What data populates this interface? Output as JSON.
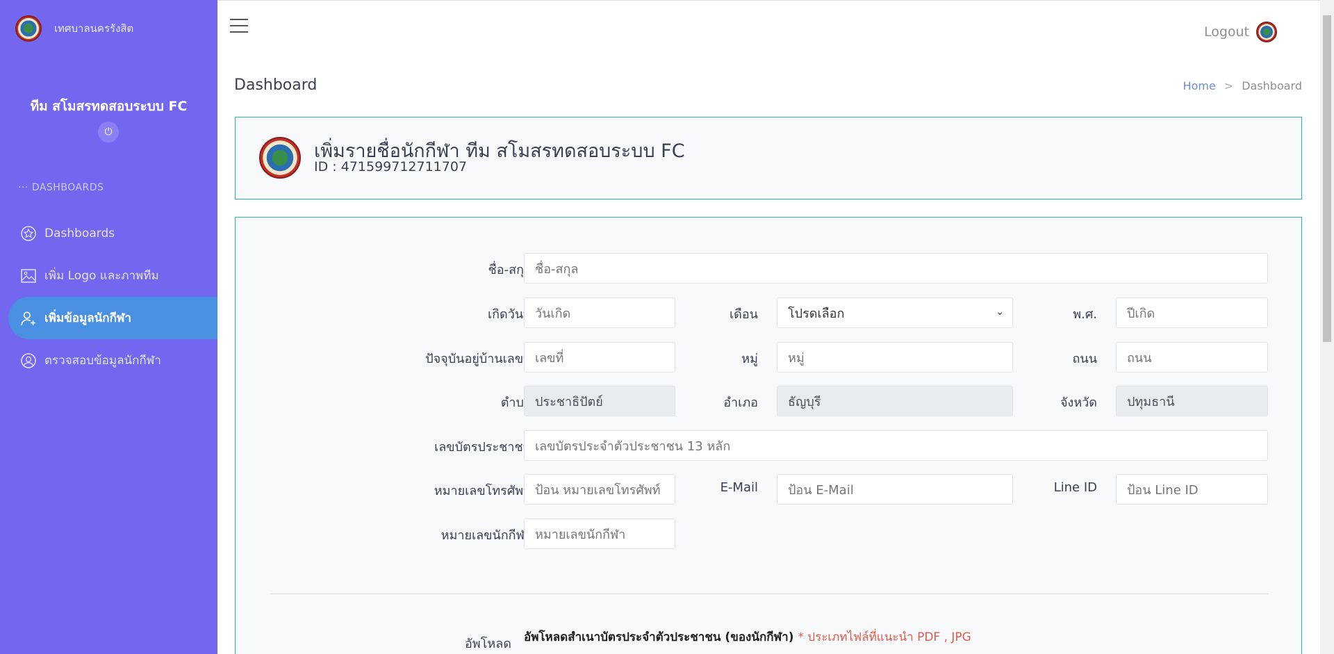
{
  "sidebar": {
    "brand": "เทศบาลนครรังสิต",
    "team_name": "ทีม สโมสรทดสอบระบบ FC",
    "section_label": "DASHBOARDS",
    "items": [
      {
        "label": "Dashboards",
        "active": false
      },
      {
        "label": "เพิ่ม Logo และภาพทีม",
        "active": false
      },
      {
        "label": "เพิ่มข้อมูลนักกีฬา",
        "active": true
      },
      {
        "label": "ตรวจสอบข้อมูลนักกีฬา",
        "active": false
      }
    ]
  },
  "header": {
    "logout_label": "Logout"
  },
  "page": {
    "title": "Dashboard",
    "breadcrumb": [
      "Home",
      "Dashboard"
    ]
  },
  "card": {
    "title": "เพิ่มรายชื่อนักกีฬา ทีม สโมสรทดสอบระบบ FC",
    "id_text": "ID : 471599712711707"
  },
  "form": {
    "fullname": {
      "label": "ชื่อ-สกุล",
      "placeholder": "ชื่อ-สกุล"
    },
    "birth_day": {
      "label": "เกิดวันที่",
      "placeholder": "วันเกิด"
    },
    "birth_month": {
      "label": "เดือน",
      "value": "โปรดเลือก"
    },
    "birth_year": {
      "label": "พ.ศ.",
      "placeholder": "ปีเกิด"
    },
    "house_no": {
      "label": "ปัจจุบันอยู่บ้านเลขที่",
      "placeholder": "เลขที่"
    },
    "moo": {
      "label": "หมู่",
      "placeholder": "หมู่"
    },
    "road": {
      "label": "ถนน",
      "placeholder": "ถนน"
    },
    "tambon": {
      "label": "ตำบล",
      "value": "ประชาธิปัตย์"
    },
    "amphoe": {
      "label": "อำเภอ",
      "value": "ธัญบุรี"
    },
    "province": {
      "label": "จังหวัด",
      "value": "ปทุมธานี"
    },
    "citizen_id": {
      "label": "เลขบัตรประชาชน",
      "placeholder": "เลขบัตรประจำตัวประชาชน 13 หลัก"
    },
    "phone": {
      "label": "หมายเลขโทรศัพท์",
      "placeholder": "ป้อน หมายเลขโทรศัพท์"
    },
    "email": {
      "label": "E-Mail",
      "placeholder": "ป้อน E-Mail"
    },
    "line_id": {
      "label": "Line ID",
      "placeholder": "ป้อน Line ID"
    },
    "athlete_no": {
      "label": "หมายเลขนักกีฬา",
      "placeholder": "หมายเลขนักกีฬา"
    },
    "upload": {
      "label": "อัพโหลด",
      "title": "อัพโหลดสำเนาบัตรประจำตัวประชาชน (ของนักกีฬา)",
      "note": "* ประเภทไฟล์ที่แนะนำ PDF , JPG"
    }
  },
  "colors": {
    "sidebar_bg": "#7367f0",
    "active_item": "#4a90e2",
    "card_border": "#29b6a0",
    "note_red": "#e05b4c"
  }
}
